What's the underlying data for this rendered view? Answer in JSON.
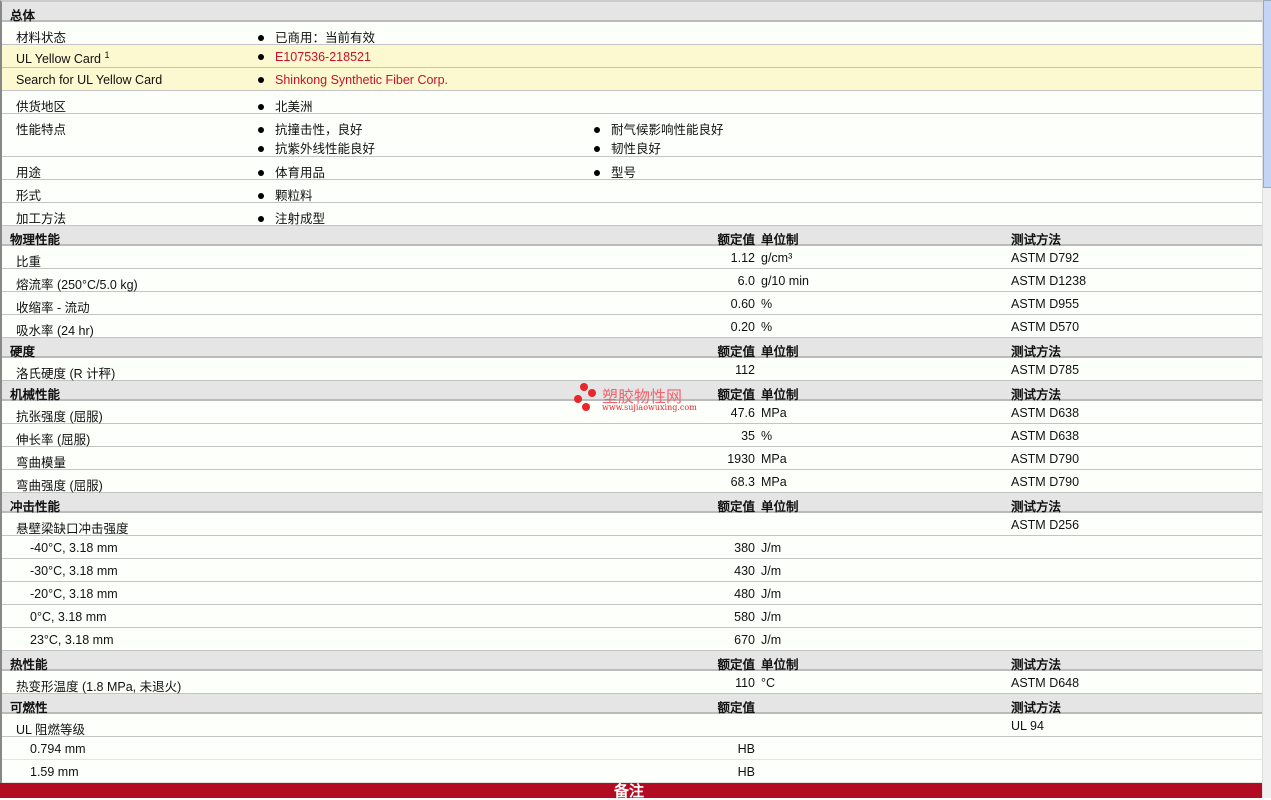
{
  "general": {
    "title": "总体",
    "rows": [
      {
        "label": "材料状态",
        "items": [
          "已商用：当前有效"
        ]
      },
      {
        "label": "UL Yellow Card",
        "sup": "1",
        "items": [
          "E107536-218521"
        ],
        "highlight": true,
        "link": true
      },
      {
        "label": "Search for UL Yellow Card",
        "items": [
          "Shinkong Synthetic Fiber Corp."
        ],
        "highlight": true,
        "link": true
      },
      {
        "label": "供货地区",
        "items": [
          "北美洲"
        ]
      },
      {
        "label": "性能特点",
        "items": [
          "抗撞击性，良好",
          "耐气候影响性能良好",
          "抗紫外线性能良好",
          "韧性良好"
        ]
      },
      {
        "label": "用途",
        "items": [
          "体育用品",
          "型号"
        ]
      },
      {
        "label": "形式",
        "items": [
          "颗粒料"
        ]
      },
      {
        "label": "加工方法",
        "items": [
          "注射成型"
        ]
      }
    ]
  },
  "sections": [
    {
      "title": "物理性能",
      "col_value": "额定值",
      "col_unit": "单位制",
      "col_test": "测试方法",
      "rows": [
        {
          "label": "比重",
          "value": "1.12",
          "unit": "g/cm³",
          "test": "ASTM D792"
        },
        {
          "label": "熔流率 (250°C/5.0 kg)",
          "value": "6.0",
          "unit": "g/10 min",
          "test": "ASTM D1238"
        },
        {
          "label": "收缩率 - 流动",
          "value": "0.60",
          "unit": "%",
          "test": "ASTM D955"
        },
        {
          "label": "吸水率 (24 hr)",
          "value": "0.20",
          "unit": "%",
          "test": "ASTM D570"
        }
      ]
    },
    {
      "title": "硬度",
      "col_value": "额定值",
      "col_unit": "单位制",
      "col_test": "测试方法",
      "rows": [
        {
          "label": "洛氏硬度 (R 计秤)",
          "value": "112",
          "unit": "",
          "test": "ASTM D785"
        }
      ]
    },
    {
      "title": "机械性能",
      "col_value": "额定值",
      "col_unit": "单位制",
      "col_test": "测试方法",
      "rows": [
        {
          "label": "抗张强度 (屈服)",
          "value": "47.6",
          "unit": "MPa",
          "test": "ASTM D638"
        },
        {
          "label": "伸长率 (屈服)",
          "value": "35",
          "unit": "%",
          "test": "ASTM D638"
        },
        {
          "label": "弯曲模量",
          "value": "1930",
          "unit": "MPa",
          "test": "ASTM D790"
        },
        {
          "label": "弯曲强度 (屈服)",
          "value": "68.3",
          "unit": "MPa",
          "test": "ASTM D790"
        }
      ]
    },
    {
      "title": "冲击性能",
      "col_value": "额定值",
      "col_unit": "单位制",
      "col_test": "测试方法",
      "rows": [
        {
          "label": "悬壁梁缺口冲击强度",
          "value": "",
          "unit": "",
          "test": "ASTM D256"
        },
        {
          "label": "-40°C, 3.18 mm",
          "value": "380",
          "unit": "J/m",
          "test": "",
          "indent": true
        },
        {
          "label": "-30°C, 3.18 mm",
          "value": "430",
          "unit": "J/m",
          "test": "",
          "indent": true
        },
        {
          "label": "-20°C, 3.18 mm",
          "value": "480",
          "unit": "J/m",
          "test": "",
          "indent": true
        },
        {
          "label": "0°C, 3.18 mm",
          "value": "580",
          "unit": "J/m",
          "test": "",
          "indent": true
        },
        {
          "label": "23°C, 3.18 mm",
          "value": "670",
          "unit": "J/m",
          "test": "",
          "indent": true
        }
      ]
    },
    {
      "title": "热性能",
      "col_value": "额定值",
      "col_unit": "单位制",
      "col_test": "测试方法",
      "rows": [
        {
          "label": "热变形温度 (1.8 MPa, 未退火)",
          "value": "110",
          "unit": "°C",
          "test": "ASTM D648"
        }
      ]
    },
    {
      "title": "可燃性",
      "col_value": "额定值",
      "col_unit": "",
      "col_test": "测试方法",
      "rows": [
        {
          "label": "UL 阻燃等级",
          "value": "",
          "unit": "",
          "test": "UL 94"
        },
        {
          "label": "0.794 mm",
          "value": "HB",
          "unit": "",
          "test": "",
          "indent": true,
          "thin": true
        },
        {
          "label": "1.59 mm",
          "value": "HB",
          "unit": "",
          "test": "",
          "indent": true,
          "thin": true
        }
      ]
    }
  ],
  "notes_label": "备注",
  "watermark": {
    "title": "塑胶物性网",
    "url": "www.sujiaowuxing.com"
  },
  "colors": {
    "notes_bar": "#b30c22",
    "highlight": "#fcf8d0",
    "link": "#c8102e",
    "header": "#e5e5e5"
  }
}
